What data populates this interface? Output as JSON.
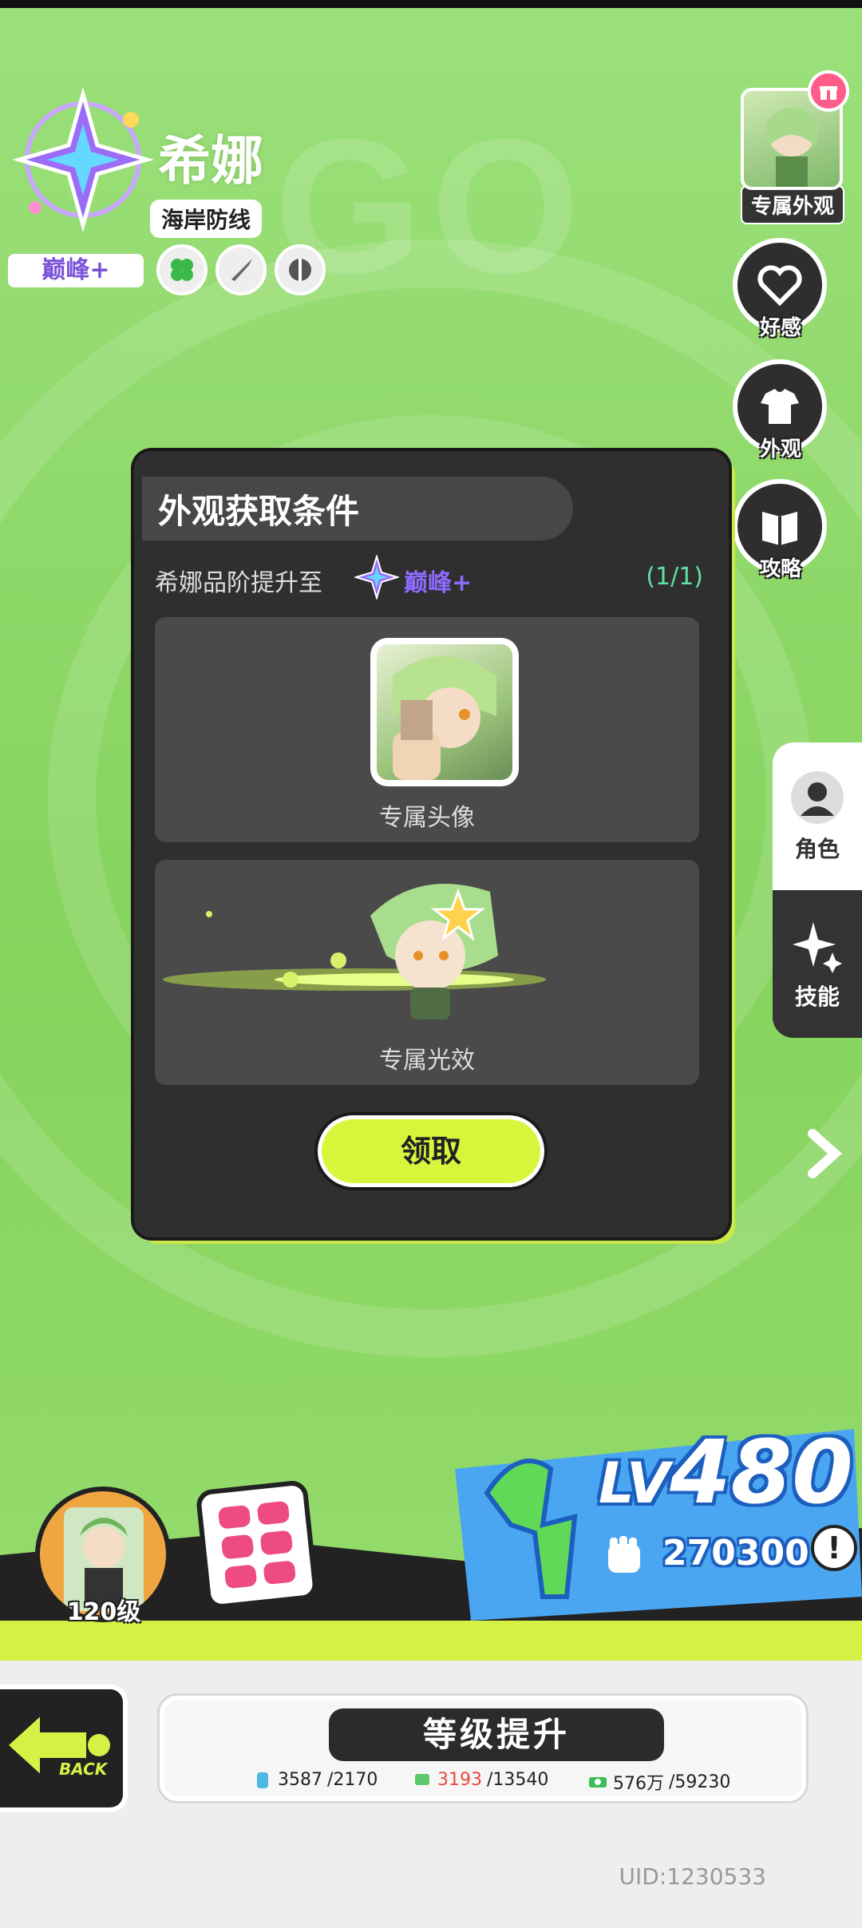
{
  "header": {
    "character_name": "希娜",
    "faction": "海岸防线",
    "rank": "巅峰+"
  },
  "right_menu": {
    "skin_label": "专属外观",
    "affection_label": "好感",
    "appearance_label": "外观",
    "guide_label": "攻略"
  },
  "side_tabs": [
    {
      "label": "角色"
    },
    {
      "label": "技能"
    }
  ],
  "modal": {
    "title": "外观获取条件",
    "condition_text": "希娜品阶提升至",
    "condition_rank": "巅峰+",
    "progress": "(1/1)",
    "rewards": [
      {
        "label": "专属头像"
      },
      {
        "label": "专属光效"
      }
    ],
    "claim_label": "领取"
  },
  "bottom": {
    "character_level": "120级",
    "lv_prefix": "LV",
    "lv_value": "480",
    "power": "270300",
    "info": "!",
    "back_label": "BACK",
    "upgrade_title": "等级提升",
    "resources": [
      {
        "have": "3587",
        "need": "/2170",
        "icon": "exp-potion-icon",
        "insufficient": false
      },
      {
        "have": "3193",
        "need": "/13540",
        "icon": "exp-book-icon",
        "insufficient": true
      },
      {
        "have": "576万",
        "need": "/59230",
        "icon": "cash-icon",
        "insufficient": false
      }
    ],
    "uid": "UID:1230533"
  },
  "colors": {
    "background": "#8ed66a",
    "accent_yellow": "#d9f53b",
    "rank_purple": "#8d6bff",
    "progress_green": "#5fe2a4",
    "lv_blue": "#1c5fbf"
  }
}
